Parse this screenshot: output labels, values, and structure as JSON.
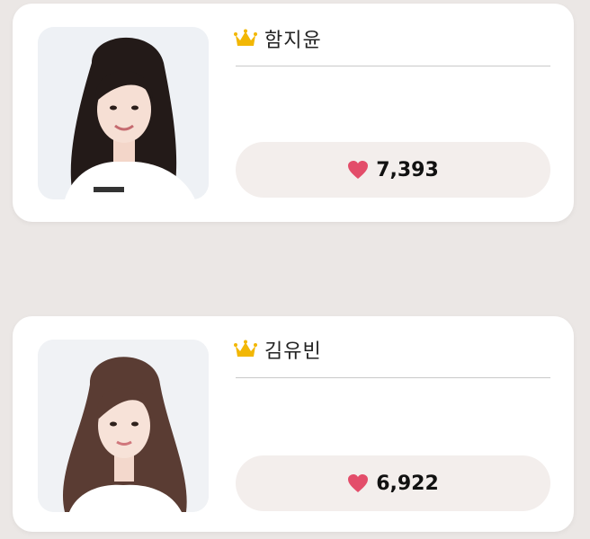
{
  "candidates": [
    {
      "name": "함지윤",
      "votes": "7,393",
      "rank_icon": "crown-icon",
      "vote_icon": "heart-icon"
    },
    {
      "name": "김유빈",
      "votes": "6,922",
      "rank_icon": "crown-icon",
      "vote_icon": "heart-icon"
    }
  ],
  "colors": {
    "crown": "#f2b705",
    "heart": "#e34d6a",
    "pill_background": "#f3eeec",
    "page_background": "#ebe7e5"
  }
}
